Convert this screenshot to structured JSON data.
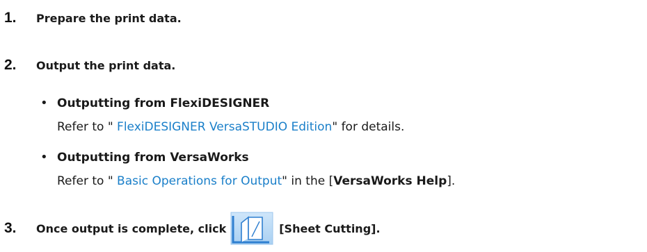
{
  "steps": [
    {
      "num": "1.",
      "text": "Prepare the print data."
    },
    {
      "num": "2.",
      "text": "Output the print data."
    },
    {
      "num": "3.",
      "text_before": "Once output is complete, click",
      "text_after": "[Sheet Cutting]."
    }
  ],
  "bullets": [
    {
      "title": "Outputting from FlexiDESIGNER",
      "prefix": "Refer to \" ",
      "link": "FlexiDESIGNER VersaSTUDIO Edition",
      "suffix": "\" for details."
    },
    {
      "title": "Outputting from VersaWorks",
      "prefix": "Refer to \" ",
      "link": "Basic Operations for Output",
      "middle": "\" in the [",
      "bold": "VersaWorks Help",
      "suffix": "]."
    }
  ],
  "bullet_glyph": "•",
  "icon": {
    "name": "sheet-cutting-icon",
    "color": "#3a8fd6"
  },
  "link_color": "#1a7fc9"
}
